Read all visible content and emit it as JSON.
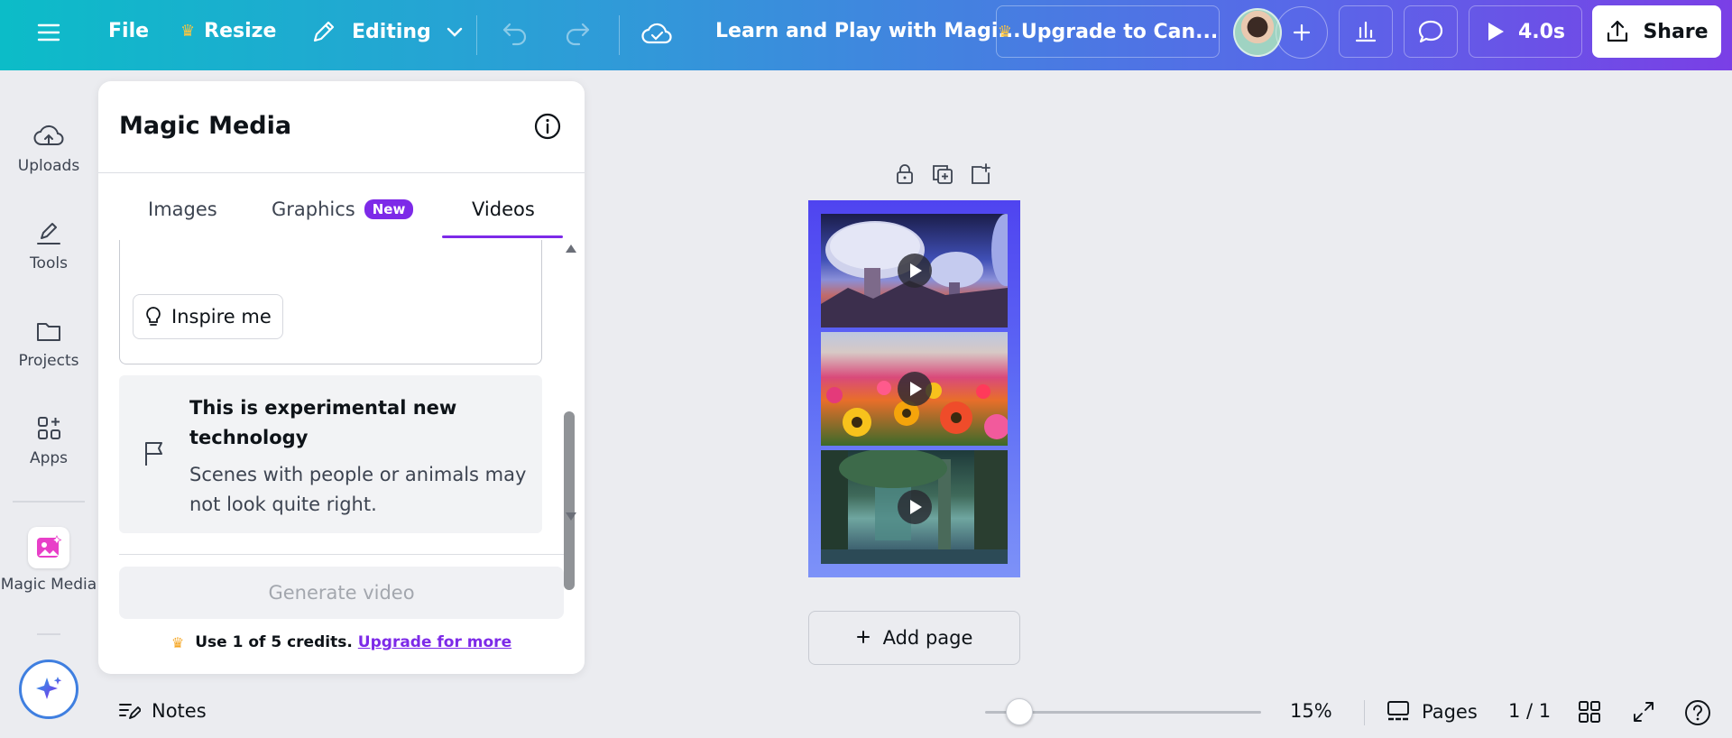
{
  "topbar": {
    "file_label": "File",
    "resize_label": "Resize",
    "mode_label": "Editing",
    "doc_title": "Learn and Play with Magi...",
    "upgrade_label": "Upgrade to Can...",
    "play_duration": "4.0s",
    "share_label": "Share"
  },
  "rail": {
    "items": [
      {
        "label": "Uploads",
        "icon": "cloud-upload-icon"
      },
      {
        "label": "Tools",
        "icon": "pen-tools-icon"
      },
      {
        "label": "Projects",
        "icon": "folder-icon"
      },
      {
        "label": "Apps",
        "icon": "apps-grid-icon"
      },
      {
        "label": "Magic Media",
        "icon": "magic-media-icon"
      }
    ]
  },
  "panel": {
    "title": "Magic Media",
    "tabs": [
      {
        "label": "Images"
      },
      {
        "label": "Graphics",
        "badge": "New"
      },
      {
        "label": "Videos",
        "active": true
      }
    ],
    "inspire_label": "Inspire me",
    "notice_title": "This is experimental new technology",
    "notice_body": "Scenes with people or animals may not look quite right.",
    "generate_label": "Generate video",
    "credits_text": "Use 1 of 5 credits.",
    "credits_link": "Upgrade for more"
  },
  "canvas": {
    "add_page_label": "Add page",
    "videos": [
      "alien-planet-mushrooms",
      "flower-field",
      "fantasy-forest"
    ]
  },
  "bottom": {
    "notes_label": "Notes",
    "zoom_level": "15%",
    "zoom_fraction": 0.12,
    "pages_label": "Pages",
    "page_count": "1 / 1"
  },
  "colors": {
    "accent": "#7d2ae8",
    "topbar_start": "#0cbcc8",
    "topbar_end": "#7a3fe6"
  }
}
